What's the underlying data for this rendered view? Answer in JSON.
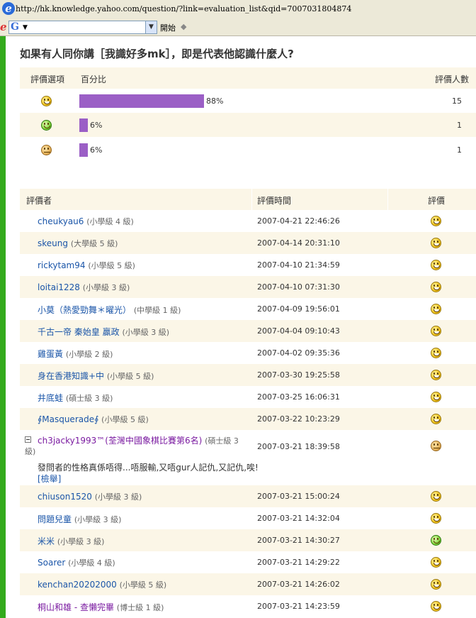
{
  "browser": {
    "url": "http://hk.knowledge.yahoo.com/question/?link=evaluation_list&qid=7007031804874",
    "toolbar_start": "開始"
  },
  "question": {
    "title": "如果有人同你講［我識好多mk］，即是代表他認識什麼人?"
  },
  "rating_table": {
    "headers": {
      "option": "評價選項",
      "percent": "百分比",
      "count": "評價人數"
    },
    "rows": [
      {
        "icon": "laughing-smiley-icon",
        "percent": 88,
        "percent_label": "88%",
        "count": "15"
      },
      {
        "icon": "green-smile-icon",
        "percent": 6,
        "percent_label": "6%",
        "count": "1"
      },
      {
        "icon": "sad-face-icon",
        "percent": 6,
        "percent_label": "6%",
        "count": "1"
      }
    ],
    "bar_color": "#9b5fc6"
  },
  "rater_list": {
    "headers": {
      "rater": "評價者",
      "time": "評價時間",
      "rating": "評價"
    },
    "rows": [
      {
        "name": "cheukyau6",
        "level": "(小學級 4 級)",
        "time": "2007-04-21 22:46:26",
        "icon": "laughing-smiley-icon"
      },
      {
        "name": "skeung",
        "level": "(大學級 5 級)",
        "time": "2007-04-14 20:31:10",
        "icon": "laughing-smiley-icon"
      },
      {
        "name": "rickytam94",
        "level": "(小學級 5 級)",
        "time": "2007-04-10 21:34:59",
        "icon": "laughing-smiley-icon"
      },
      {
        "name": "loitai1228",
        "level": "(小學級 3 級)",
        "time": "2007-04-10 07:31:30",
        "icon": "laughing-smiley-icon"
      },
      {
        "name": "小莫（熱愛勁舞＊曜光）",
        "level": "(中學級 1 級)",
        "time": "2007-04-09 19:56:01",
        "icon": "laughing-smiley-icon"
      },
      {
        "name": "千古一帝 秦始皇 贏政",
        "level": "(小學級 3 級)",
        "time": "2007-04-04 09:10:43",
        "icon": "laughing-smiley-icon"
      },
      {
        "name": "雞蛋黃",
        "level": "(小學級 2 級)",
        "time": "2007-04-02 09:35:36",
        "icon": "laughing-smiley-icon"
      },
      {
        "name": "身在香港知識+中",
        "level": "(小學級 5 級)",
        "time": "2007-03-30 19:25:58",
        "icon": "laughing-smiley-icon"
      },
      {
        "name": "井底蛙",
        "level": "(碩士級 3 級)",
        "time": "2007-03-25 16:06:31",
        "icon": "laughing-smiley-icon"
      },
      {
        "name": "∮Masquerade∮",
        "level": "(小學級 5 級)",
        "time": "2007-03-22 10:23:29",
        "icon": "laughing-smiley-icon"
      }
    ],
    "expanded_row": {
      "name": "ch3jacky1993™",
      "tag": "(荃灣中國象棋比賽第6名)",
      "level_a": "(碩士級 3",
      "level_b": "級)",
      "time": "2007-03-21 18:39:58",
      "icon": "sad-face-icon",
      "comment": "發問者的性格真係唔得...唔服輸,又唔gur人記仇,又記仇,唉!",
      "report": "[檢舉]"
    },
    "rows2": [
      {
        "name": "chiuson1520",
        "level": "(小學級 3 級)",
        "time": "2007-03-21 15:00:24",
        "icon": "laughing-smiley-icon"
      },
      {
        "name": "問題兒童",
        "level": "(小學級 3 級)",
        "time": "2007-03-21 14:32:04",
        "icon": "laughing-smiley-icon"
      },
      {
        "name": "米米",
        "level": "(小學級 3 級)",
        "time": "2007-03-21 14:30:27",
        "icon": "green-smile-icon"
      },
      {
        "name": "Soarer",
        "level": "(小學級 4 級)",
        "time": "2007-03-21 14:29:22",
        "icon": "laughing-smiley-icon"
      },
      {
        "name": "kenchan20202000",
        "level": "(小學級 5 級)",
        "time": "2007-03-21 14:26:02",
        "icon": "laughing-smiley-icon"
      },
      {
        "name": "桐山和雄 - 查懶完畢",
        "level": "(博士級 1 級)",
        "time": "2007-03-21 14:23:59",
        "icon": "laughing-smiley-icon",
        "purple": true
      }
    ]
  }
}
